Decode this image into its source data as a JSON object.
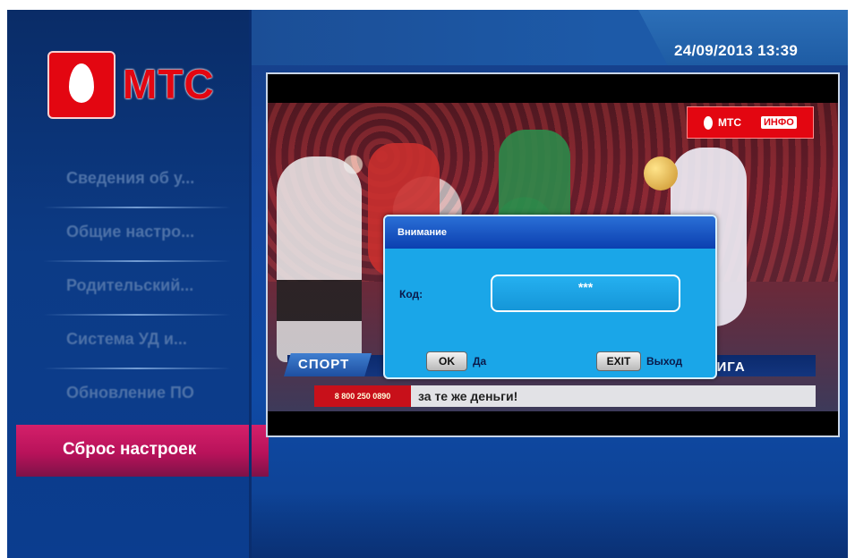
{
  "header": {
    "datetime": "24/09/2013 13:39"
  },
  "logo": {
    "text": "МТС"
  },
  "sidebar": {
    "items": [
      {
        "label": "Сведения об у..."
      },
      {
        "label": "Общие настро..."
      },
      {
        "label": "Родительский..."
      },
      {
        "label": "Система УД и..."
      },
      {
        "label": "Обновление ПО"
      },
      {
        "label": "Сброс настроек",
        "active": true
      }
    ]
  },
  "tv": {
    "channel_badge": {
      "brand": "МТС",
      "label": "ИНФО"
    },
    "sport_badge": "СПОРТ",
    "league_text": "ЛИГА",
    "ticker_phone": "8 800 250 0890",
    "ticker_message": "за те же деньги!"
  },
  "dialog": {
    "title": "Внимание",
    "code_label": "Код:",
    "code_value": "***",
    "ok_key": "OK",
    "ok_label": "Да",
    "exit_key": "EXIT",
    "exit_label": "Выход"
  },
  "colors": {
    "brand_red": "#e30611",
    "active_item": "#c81a63",
    "dialog_bg": "#1aa6e8",
    "background": "#0c3f93"
  }
}
